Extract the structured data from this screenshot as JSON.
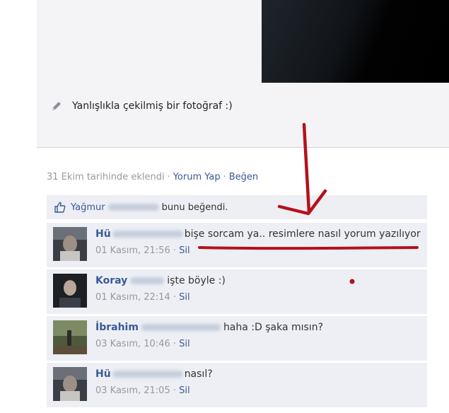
{
  "post": {
    "caption": "Yanlışlıkla çekilmiş bir fotoğraf :)",
    "added": "31 Ekim tarihinde eklendi",
    "comment_action": "Yorum Yap",
    "like_action": "Beğen"
  },
  "likes": {
    "user": "Yağmur",
    "text": "bunu beğendi."
  },
  "comments": [
    {
      "author": "Hü",
      "text": "bişe sorcam ya.. resimlere nasıl yorum yazılıyor",
      "time": "01 Kasım, 21:56",
      "delete": "Sil"
    },
    {
      "author": "Koray",
      "text": "işte böyle :)",
      "time": "01 Kasım, 22:14",
      "delete": "Sil"
    },
    {
      "author": "İbrahim",
      "text": "haha :D şaka mısın?",
      "time": "03 Kasım, 10:46",
      "delete": "Sil"
    },
    {
      "author": "Hü",
      "text": "nasıl?",
      "time": "03 Kasım, 21:05",
      "delete": "Sil"
    }
  ],
  "colors": {
    "link": "#3b5998",
    "comment_bg": "#edeff4",
    "annotation": "#b3121c"
  },
  "icons": [
    "pencil-icon",
    "thumbs-up-icon"
  ]
}
